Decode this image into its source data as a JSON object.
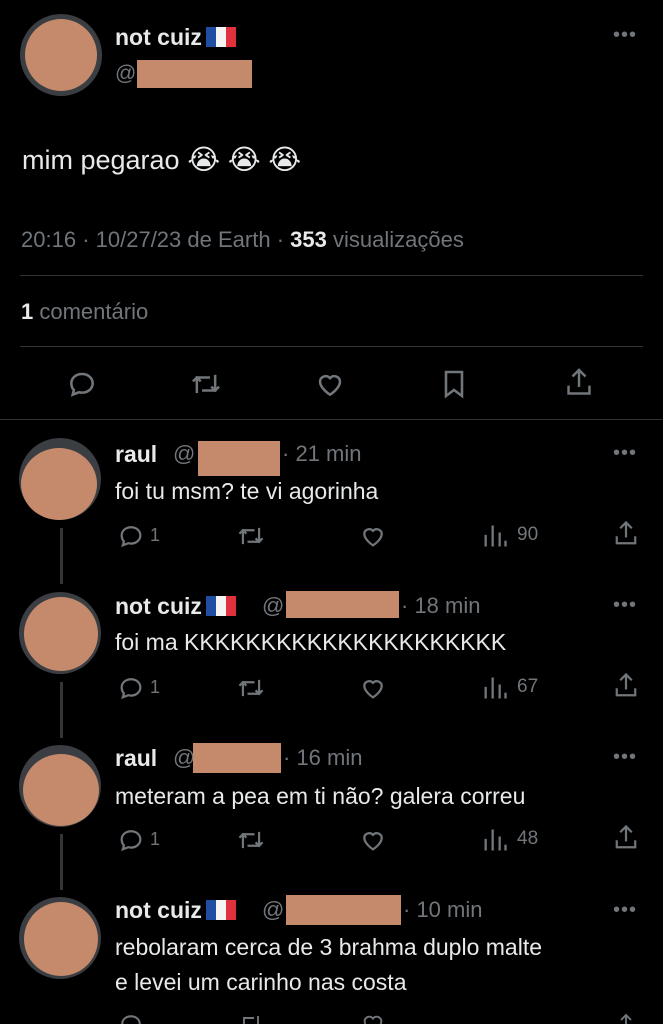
{
  "main_tweet": {
    "author_name": "not cuiz",
    "handle_prefix": "@",
    "text": "mim pegarao",
    "emojis": [
      "loudly-crying-face",
      "loudly-crying-face",
      "loudly-crying-face"
    ],
    "time": "20:16",
    "separator": "·",
    "date": "10/27/23 de Earth",
    "views_count": "353",
    "views_label": "visualizações",
    "comments_count": "1",
    "comments_label": "comentário"
  },
  "action_icons": [
    "reply-icon",
    "retweet-icon",
    "like-icon",
    "bookmark-icon",
    "share-icon"
  ],
  "replies": [
    {
      "name": "raul",
      "handle_prefix": "@",
      "time": "· 21 min",
      "text": "foi tu msm? te vi agorinha",
      "reply_count": "1",
      "views": "90"
    },
    {
      "name": "not cuiz",
      "handle_prefix": "@",
      "time": "· 18 min",
      "text": "foi ma KKKKKKKKKKKKKKKKKKKKK",
      "reply_count": "1",
      "views": "67"
    },
    {
      "name": "raul",
      "handle_prefix": "@",
      "time": "· 16 min",
      "text": "meteram a pea em ti não? galera correu",
      "reply_count": "1",
      "views": "48"
    },
    {
      "name": "not cuiz",
      "handle_prefix": "@",
      "time": "· 10 min",
      "text_line1": "rebolaram cerca de 3 brahma duplo malte",
      "text_line2": "e levei um carinho nas costa"
    }
  ],
  "colors": {
    "background": "#000000",
    "text": "#e7e9ea",
    "muted": "#71767b",
    "divider": "#2f3336",
    "redaction": "#c58a6c"
  }
}
